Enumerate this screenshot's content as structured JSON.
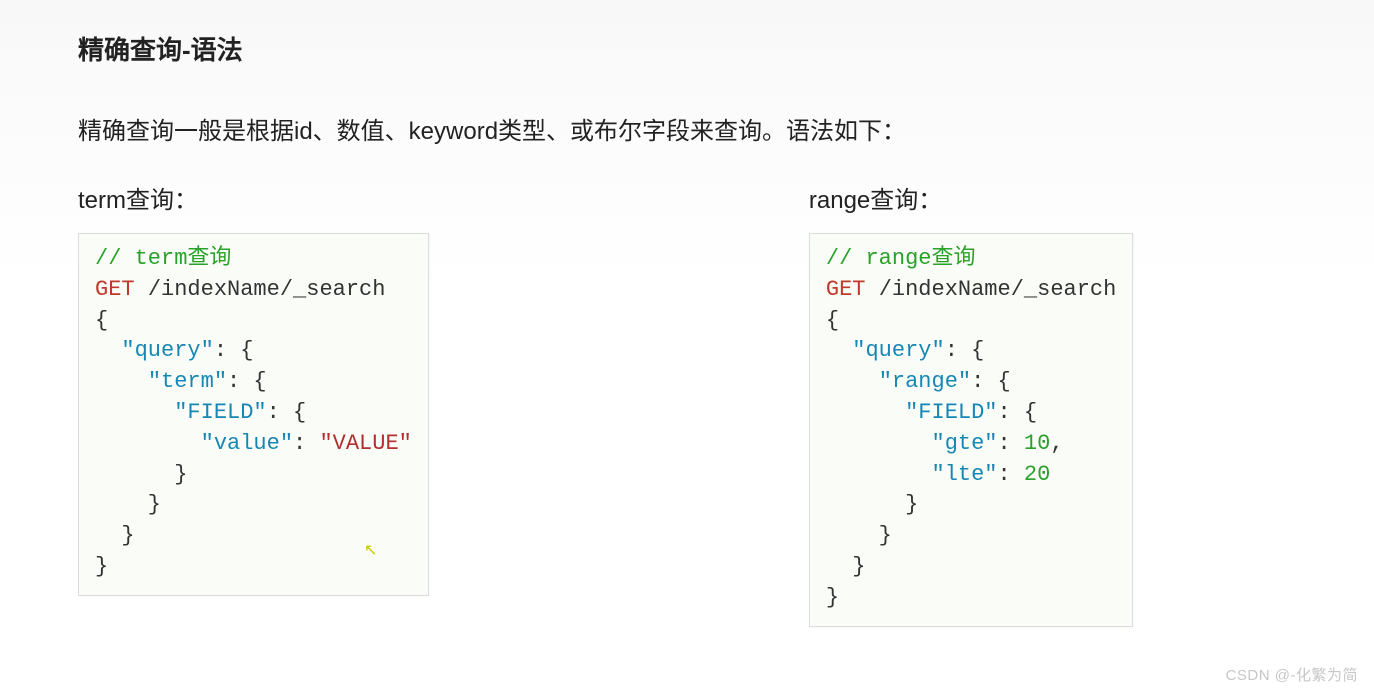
{
  "title": "精确查询-语法",
  "intro": "精确查询一般是根据id、数值、keyword类型、或布尔字段来查询。语法如下：",
  "left": {
    "label": "term查询：",
    "code": {
      "comment": "// term查询",
      "method": "GET",
      "path": "/indexName/_search",
      "l1": "{",
      "l2a": "  ",
      "l2k": "\"query\"",
      "l2p": ": {",
      "l3a": "    ",
      "l3k": "\"term\"",
      "l3p": ": {",
      "l4a": "      ",
      "l4k": "\"FIELD\"",
      "l4p": ": {",
      "l5a": "        ",
      "l5k": "\"value\"",
      "l5p": ": ",
      "l5v": "\"VALUE\"",
      "l6": "      }",
      "l7": "    }",
      "l8": "  }",
      "l9": "}"
    }
  },
  "right": {
    "label": "range查询：",
    "code": {
      "comment": "// range查询",
      "method": "GET",
      "path": "/indexName/_search",
      "l1": "{",
      "l2a": "  ",
      "l2k": "\"query\"",
      "l2p": ": {",
      "l3a": "    ",
      "l3k": "\"range\"",
      "l3p": ": {",
      "l4a": "      ",
      "l4k": "\"FIELD\"",
      "l4p": ": {",
      "l5a": "        ",
      "l5k": "\"gte\"",
      "l5p": ": ",
      "l5v": "10",
      "l5c": ",",
      "l6a": "        ",
      "l6k": "\"lte\"",
      "l6p": ": ",
      "l6v": "20",
      "l7": "      }",
      "l8": "    }",
      "l9": "  }",
      "l10": "}"
    }
  },
  "watermark": "CSDN @-化繁为简"
}
